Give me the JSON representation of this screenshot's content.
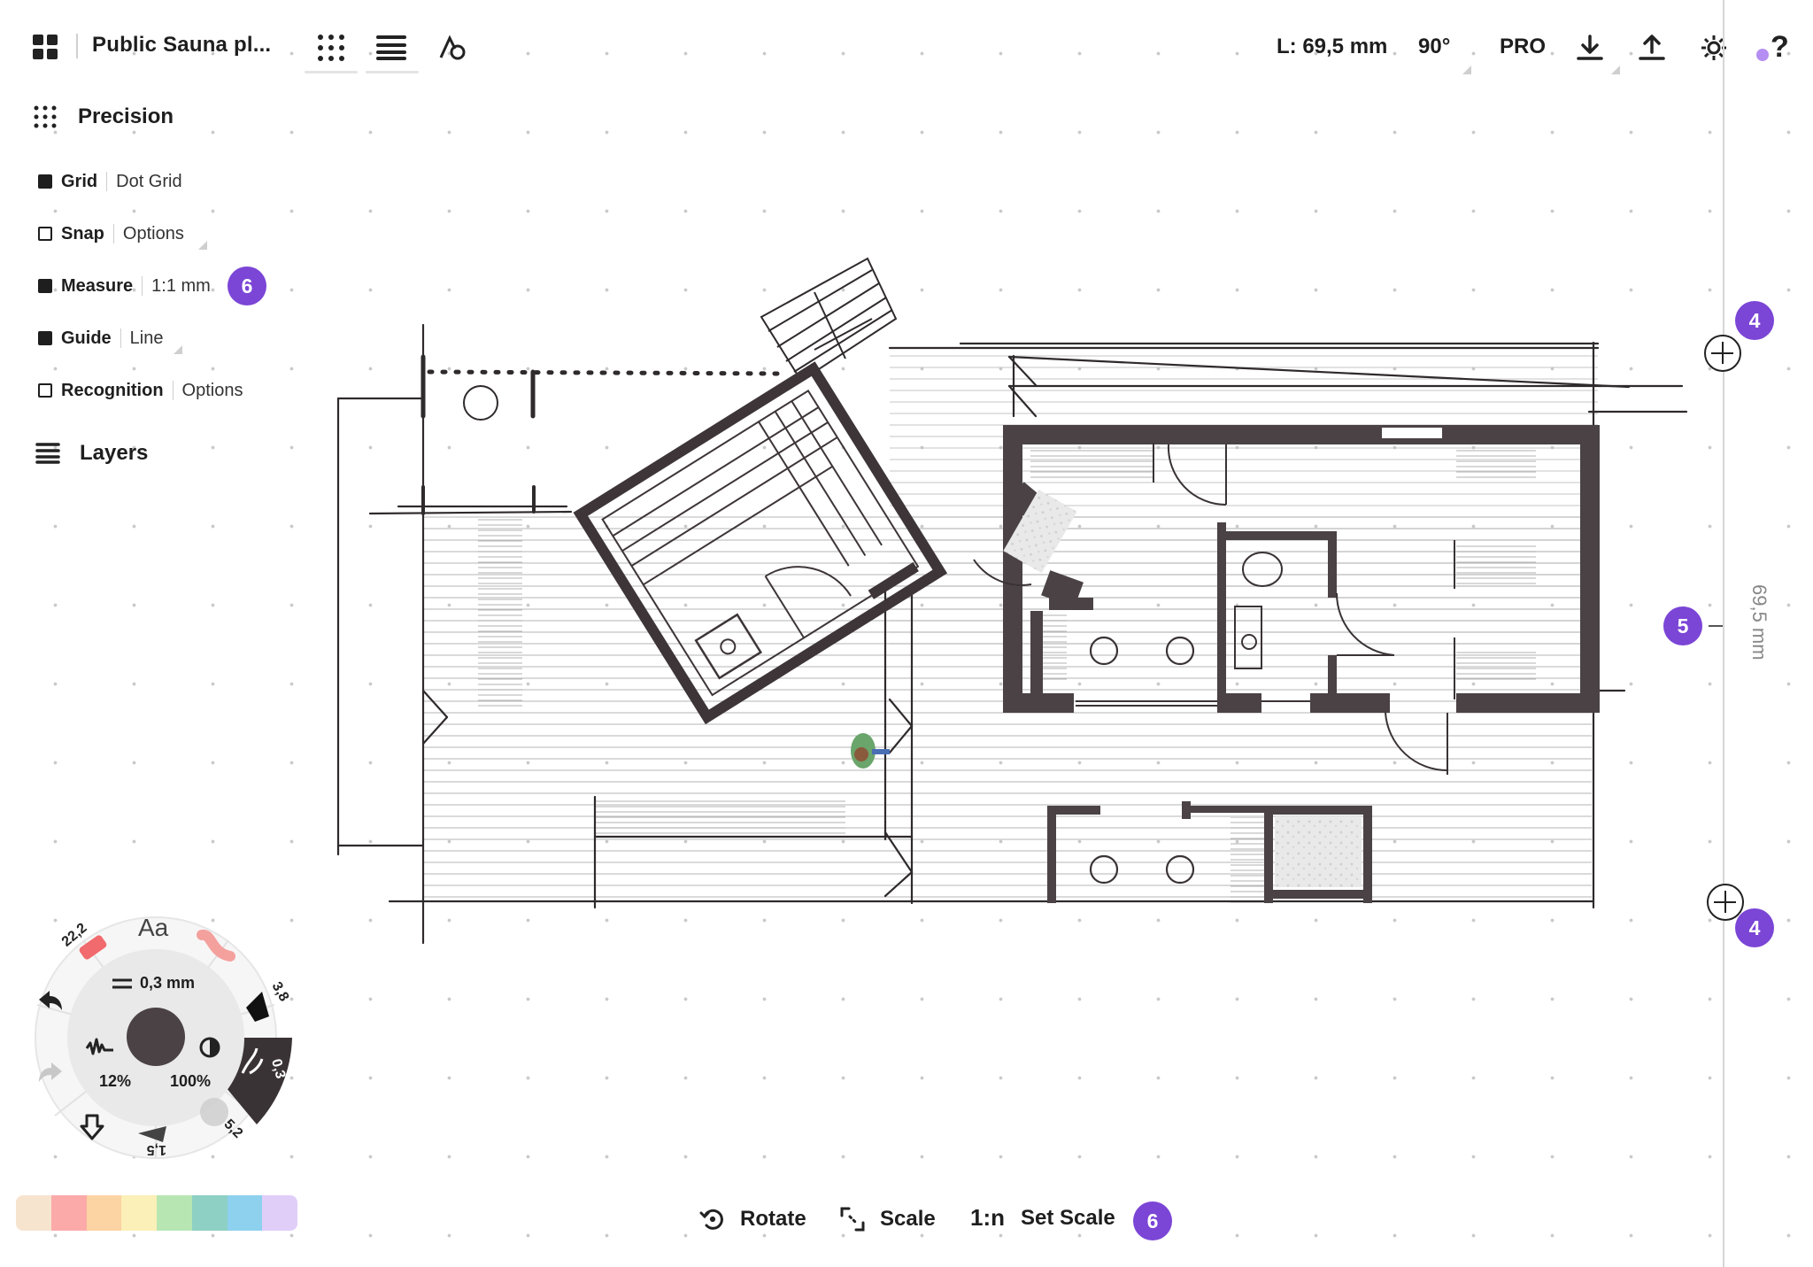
{
  "topbar": {
    "doc_title": "Public Sauna pl...",
    "length_readout": "L: 69,5 mm",
    "angle_readout": "90°",
    "pro_label": "PRO",
    "icons": [
      "gallery-icon",
      "precision-grid-icon",
      "layers-icon",
      "shapes-icon",
      "download-icon",
      "upload-icon",
      "settings-icon",
      "help-icon"
    ]
  },
  "precision": {
    "title": "Precision",
    "rows": [
      {
        "label": "Grid",
        "value": "Dot Grid",
        "checked": true
      },
      {
        "label": "Snap",
        "value": "Options",
        "checked": false
      },
      {
        "label": "Measure",
        "value": "1:1 mm",
        "checked": true,
        "badge": "6"
      },
      {
        "label": "Guide",
        "value": "Line",
        "checked": true
      },
      {
        "label": "Recognition",
        "value": "Options",
        "checked": false
      }
    ]
  },
  "layers": {
    "title": "Layers"
  },
  "guide": {
    "top_badge": "4",
    "bottom_badge": "4",
    "mid_badge": "5",
    "dimension_label": "69,5 mm"
  },
  "bottom_toolbar": {
    "rotate": "Rotate",
    "scale": "Scale",
    "ratio": "1:n",
    "set_scale": "Set Scale",
    "badge": "6"
  },
  "tool_wheel": {
    "text_tool": "Aa",
    "eraser_size": "22,2",
    "marker_size": "3,8",
    "pen_size": "0,3",
    "airbrush_size": "5,2",
    "brush_size": "1,5",
    "stroke_width": "0,3 mm",
    "smoothing": "12%",
    "opacity": "100%",
    "current_color": "#4a4244"
  },
  "palette": [
    "#f7e4cf",
    "#fbaaa9",
    "#fcd3a3",
    "#fbf0b7",
    "#b8e6b3",
    "#8ed0c4",
    "#8ed1ee",
    "#e1cef8"
  ],
  "accent_color": "#7b45d6"
}
